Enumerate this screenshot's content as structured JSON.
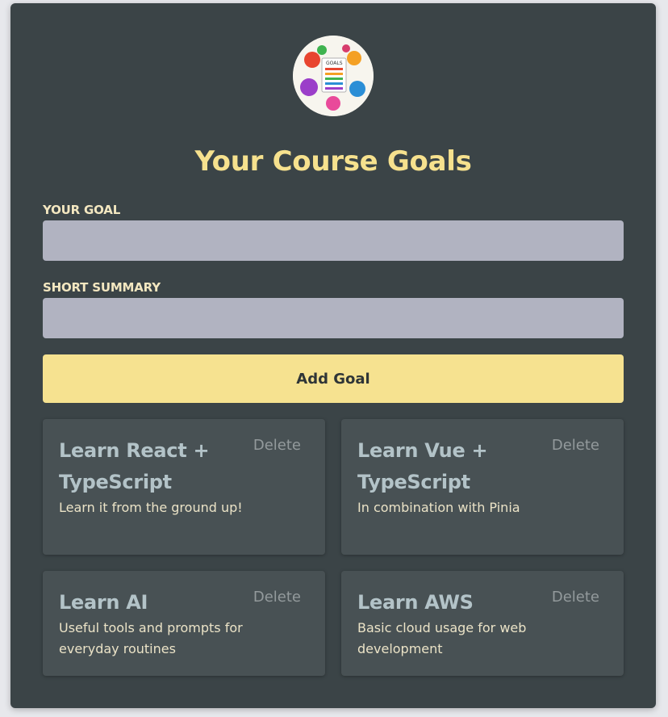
{
  "header": {
    "logo_icon": "goals-logo",
    "title": "Your Course Goals"
  },
  "form": {
    "goal_label": "YOUR GOAL",
    "goal_value": "",
    "summary_label": "SHORT SUMMARY",
    "summary_value": "",
    "submit_label": "Add Goal"
  },
  "goals": [
    {
      "title": "Learn React + TypeScript",
      "summary": "Learn it from the ground up!",
      "delete_label": "Delete"
    },
    {
      "title": "Learn Vue + TypeScript",
      "summary": "In combination with Pinia",
      "delete_label": "Delete"
    },
    {
      "title": "Learn AI",
      "summary": "Useful tools and prompts for everyday routines",
      "delete_label": "Delete"
    },
    {
      "title": "Learn AWS",
      "summary": "Basic cloud usage for web development",
      "delete_label": "Delete"
    }
  ],
  "colors": {
    "background": "#3b4447",
    "accent": "#f6e18e",
    "input": "#b1b3c1",
    "goal_card": "#485154"
  }
}
